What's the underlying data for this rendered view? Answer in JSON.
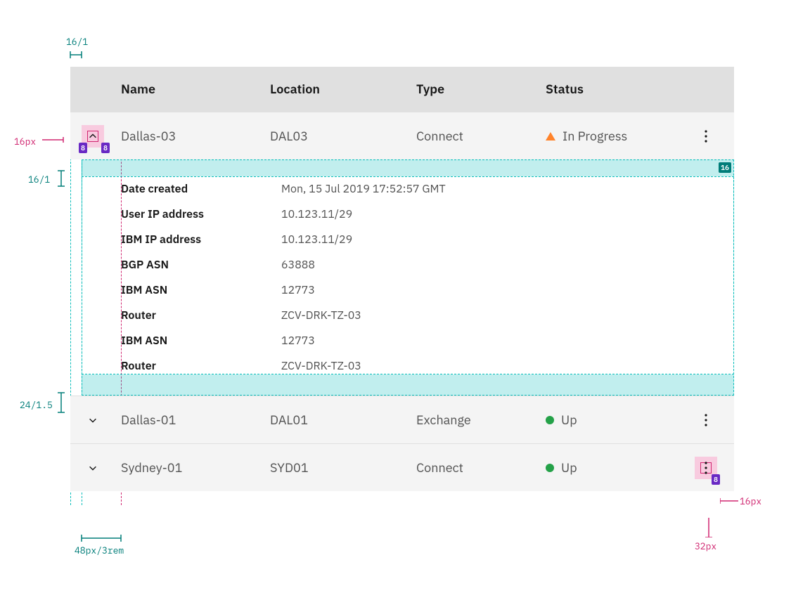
{
  "columns": {
    "name": "Name",
    "location": "Location",
    "type": "Type",
    "status": "Status"
  },
  "rows": [
    {
      "expanded": true,
      "name": "Dallas-03",
      "location": "DAL03",
      "type": "Connect",
      "status": "In Progress",
      "status_state": "warn",
      "details": [
        {
          "k": "Date created",
          "v": "Mon, 15 Jul 2019 17:52:57 GMT"
        },
        {
          "k": "User IP address",
          "v": "10.123.11/29"
        },
        {
          "k": "IBM IP address",
          "v": "10.123.11/29"
        },
        {
          "k": "BGP ASN",
          "v": "63888"
        },
        {
          "k": "IBM ASN",
          "v": "12773"
        },
        {
          "k": "Router",
          "v": "ZCV-DRK-TZ-03"
        },
        {
          "k": "IBM ASN",
          "v": "12773"
        },
        {
          "k": "Router",
          "v": "ZCV-DRK-TZ-03"
        }
      ]
    },
    {
      "expanded": false,
      "name": "Dallas-01",
      "location": "DAL01",
      "type": "Exchange",
      "status": "Up",
      "status_state": "ok"
    },
    {
      "expanded": false,
      "name": "Sydney-01",
      "location": "SYD01",
      "type": "Connect",
      "status": "Up",
      "status_state": "ok"
    }
  ],
  "annotations": {
    "top_gutter": "16/1",
    "expander_px": "16px",
    "expander_pad_left": "8",
    "expander_pad_right": "8",
    "top_pad": "16/1",
    "bottom_pad": "24/1.5",
    "left_indent": "48px/3rem",
    "overflow_icon_px": "16px",
    "overflow_box_px": "32px",
    "overflow_pad": "8",
    "inner_top_pad": "16"
  }
}
